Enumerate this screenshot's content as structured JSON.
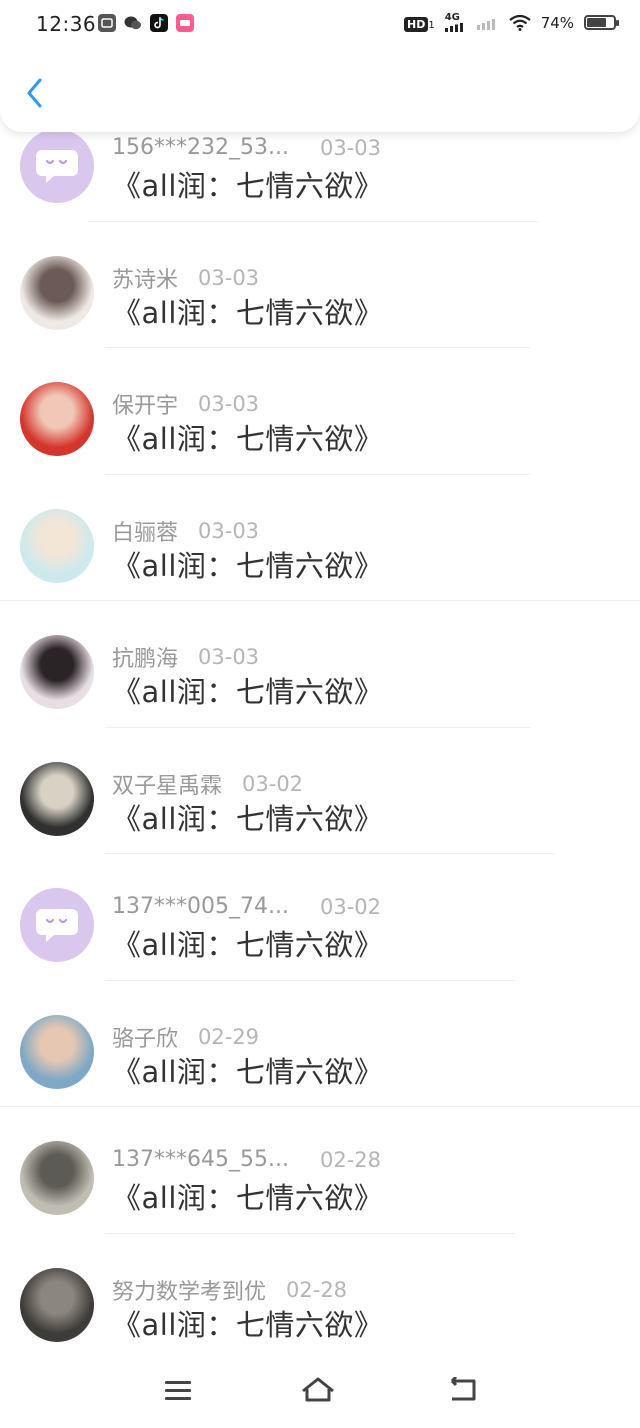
{
  "status_bar": {
    "time": "12:36",
    "network_badge": "HD",
    "network_sub": "1",
    "signal_label": "4G",
    "battery_text": "74%",
    "battery_level": 0.74
  },
  "nav": {
    "back_icon": "chevron-left-icon",
    "accent_color": "#2f9bec"
  },
  "messages": [
    {
      "name": "156***232_53...",
      "date": "03-03",
      "text": "《all润：七情六欲》",
      "avatar": "default-chat-avatar",
      "truncated": true
    },
    {
      "name": "苏诗米",
      "date": "03-03",
      "text": "《all润：七情六欲》",
      "avatar": "photo-avatar",
      "truncated": false
    },
    {
      "name": "保开宇",
      "date": "03-03",
      "text": "《all润：七情六欲》",
      "avatar": "photo-avatar",
      "truncated": false
    },
    {
      "name": "白骊蓉",
      "date": "03-03",
      "text": "《all润：七情六欲》",
      "avatar": "photo-avatar",
      "truncated": false
    },
    {
      "name": "抗鹏海",
      "date": "03-03",
      "text": "《all润：七情六欲》",
      "avatar": "photo-avatar",
      "truncated": false
    },
    {
      "name": "双子星禹霖",
      "date": "03-02",
      "text": "《all润：七情六欲》",
      "avatar": "photo-avatar",
      "truncated": false
    },
    {
      "name": "137***005_74...",
      "date": "03-02",
      "text": "《all润：七情六欲》",
      "avatar": "default-chat-avatar",
      "truncated": true
    },
    {
      "name": "骆子欣",
      "date": "02-29",
      "text": "《all润：七情六欲》",
      "avatar": "photo-avatar",
      "truncated": false
    },
    {
      "name": "137***645_55...",
      "date": "02-28",
      "text": "《all润：七情六欲》",
      "avatar": "photo-avatar",
      "truncated": true
    },
    {
      "name": "努力数学考到优",
      "date": "02-28",
      "text": "《all润：七情六欲》",
      "avatar": "photo-avatar",
      "truncated": false
    }
  ],
  "bottom_nav": {
    "menu_icon": "menu-icon",
    "home_icon": "home-icon",
    "back_icon": "back-icon"
  }
}
